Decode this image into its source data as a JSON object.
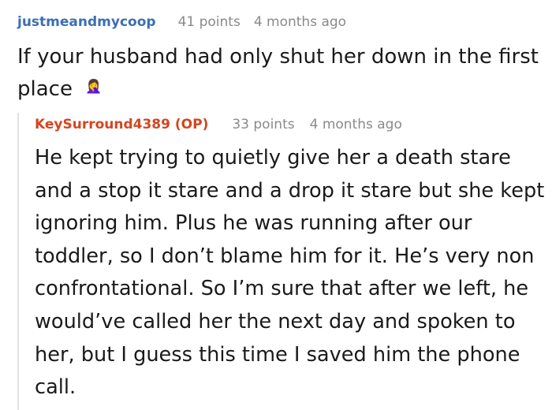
{
  "comments": [
    {
      "author": "justmeandmycoop",
      "points": "41 points",
      "age": "4 months ago",
      "body": "If your husband had only shut her down in the first place",
      "emoji": "🤦‍♀️"
    },
    {
      "author": "KeySurround4389 (OP)",
      "points": "33 points",
      "age": "4 months ago",
      "body": "He kept trying to quietly give her a death stare and a stop it stare and a drop it stare but she kept ignoring him. Plus he was running after our toddler, so I don’t blame him for it. He’s very non confrontational. So I’m sure that after we left, he would’ve called her the next day and spoken to her, but I guess this time I saved him the phone call."
    }
  ]
}
